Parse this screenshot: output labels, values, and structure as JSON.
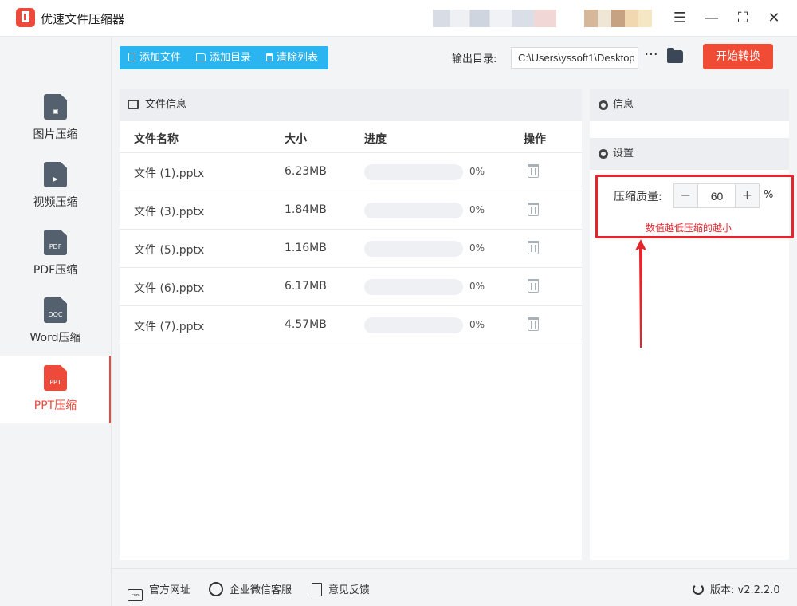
{
  "app": {
    "title": "优速文件压缩器"
  },
  "window": {
    "menu_icon": "☰",
    "minimize_icon": "—",
    "maximize_icon": "⛶",
    "close_icon": "✕"
  },
  "sidebar": {
    "items": [
      {
        "label": "图片压缩",
        "icon_text": "▣",
        "active": false
      },
      {
        "label": "视频压缩",
        "icon_text": "▶",
        "active": false
      },
      {
        "label": "PDF压缩",
        "icon_text": "PDF",
        "active": false
      },
      {
        "label": "Word压缩",
        "icon_text": "DOC",
        "active": false
      },
      {
        "label": "PPT压缩",
        "icon_text": "PPT",
        "active": true
      }
    ]
  },
  "toolbar": {
    "add_file": "添加文件",
    "add_folder": "添加目录",
    "clear_list": "清除列表",
    "output_label": "输出目录:",
    "output_path": "C:\\Users\\yssoft1\\Desktop",
    "more": "···",
    "start": "开始转换"
  },
  "files": {
    "header": "文件信息",
    "columns": {
      "name": "文件名称",
      "size": "大小",
      "progress": "进度",
      "action": "操作"
    },
    "rows": [
      {
        "name": "文件 (1).pptx",
        "size": "6.23MB",
        "progress": "0%",
        "progress_value": 0
      },
      {
        "name": "文件 (3).pptx",
        "size": "1.84MB",
        "progress": "0%",
        "progress_value": 0
      },
      {
        "name": "文件 (5).pptx",
        "size": "1.16MB",
        "progress": "0%",
        "progress_value": 0
      },
      {
        "name": "文件 (6).pptx",
        "size": "6.17MB",
        "progress": "0%",
        "progress_value": 0
      },
      {
        "name": "文件 (7).pptx",
        "size": "4.57MB",
        "progress": "0%",
        "progress_value": 0
      }
    ]
  },
  "info": {
    "header": "信息"
  },
  "settings": {
    "header": "设置",
    "quality_label": "压缩质量:",
    "minus": "−",
    "plus": "+",
    "quality_value": "60",
    "unit": "%",
    "hint": "数值越低压缩的越小"
  },
  "footer": {
    "website": "官方网址",
    "wechat": "企业微信客服",
    "feedback": "意见反馈",
    "version": "版本: v2.2.2.0",
    "web_icon_text": ".com"
  },
  "colors": {
    "accent_blue": "#2bb5f0",
    "accent_red": "#ef4b35",
    "highlight": "#e5252c"
  }
}
